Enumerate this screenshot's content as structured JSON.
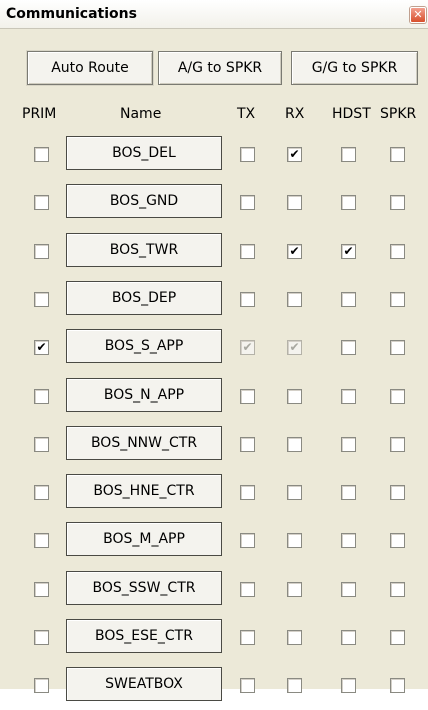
{
  "window": {
    "title": "Communications",
    "close_glyph": "✕"
  },
  "toolbar": {
    "auto_route_label": "Auto Route",
    "ag_to_spkr_label": "A/G to SPKR",
    "gg_to_spkr_label": "G/G to SPKR"
  },
  "columns": {
    "prim": "PRIM",
    "name": "Name",
    "tx": "TX",
    "rx": "RX",
    "hdst": "HDST",
    "spkr": "SPKR"
  },
  "check_glyph": "✔",
  "rows": [
    {
      "name": "BOS_DEL",
      "prim": false,
      "tx": false,
      "rx": true,
      "hdst": false,
      "spkr": false,
      "tx_disabled": false,
      "rx_disabled": false
    },
    {
      "name": "BOS_GND",
      "prim": false,
      "tx": false,
      "rx": false,
      "hdst": false,
      "spkr": false,
      "tx_disabled": false,
      "rx_disabled": false
    },
    {
      "name": "BOS_TWR",
      "prim": false,
      "tx": false,
      "rx": true,
      "hdst": true,
      "spkr": false,
      "tx_disabled": false,
      "rx_disabled": false
    },
    {
      "name": "BOS_DEP",
      "prim": false,
      "tx": false,
      "rx": false,
      "hdst": false,
      "spkr": false,
      "tx_disabled": false,
      "rx_disabled": false
    },
    {
      "name": "BOS_S_APP",
      "prim": true,
      "tx": true,
      "rx": true,
      "hdst": false,
      "spkr": false,
      "tx_disabled": true,
      "rx_disabled": true
    },
    {
      "name": "BOS_N_APP",
      "prim": false,
      "tx": false,
      "rx": false,
      "hdst": false,
      "spkr": false,
      "tx_disabled": false,
      "rx_disabled": false
    },
    {
      "name": "BOS_NNW_CTR",
      "prim": false,
      "tx": false,
      "rx": false,
      "hdst": false,
      "spkr": false,
      "tx_disabled": false,
      "rx_disabled": false
    },
    {
      "name": "BOS_HNE_CTR",
      "prim": false,
      "tx": false,
      "rx": false,
      "hdst": false,
      "spkr": false,
      "tx_disabled": false,
      "rx_disabled": false
    },
    {
      "name": "BOS_M_APP",
      "prim": false,
      "tx": false,
      "rx": false,
      "hdst": false,
      "spkr": false,
      "tx_disabled": false,
      "rx_disabled": false
    },
    {
      "name": "BOS_SSW_CTR",
      "prim": false,
      "tx": false,
      "rx": false,
      "hdst": false,
      "spkr": false,
      "tx_disabled": false,
      "rx_disabled": false
    },
    {
      "name": "BOS_ESE_CTR",
      "prim": false,
      "tx": false,
      "rx": false,
      "hdst": false,
      "spkr": false,
      "tx_disabled": false,
      "rx_disabled": false
    },
    {
      "name": "SWEATBOX",
      "prim": false,
      "tx": false,
      "rx": false,
      "hdst": false,
      "spkr": false,
      "tx_disabled": false,
      "rx_disabled": false
    }
  ]
}
